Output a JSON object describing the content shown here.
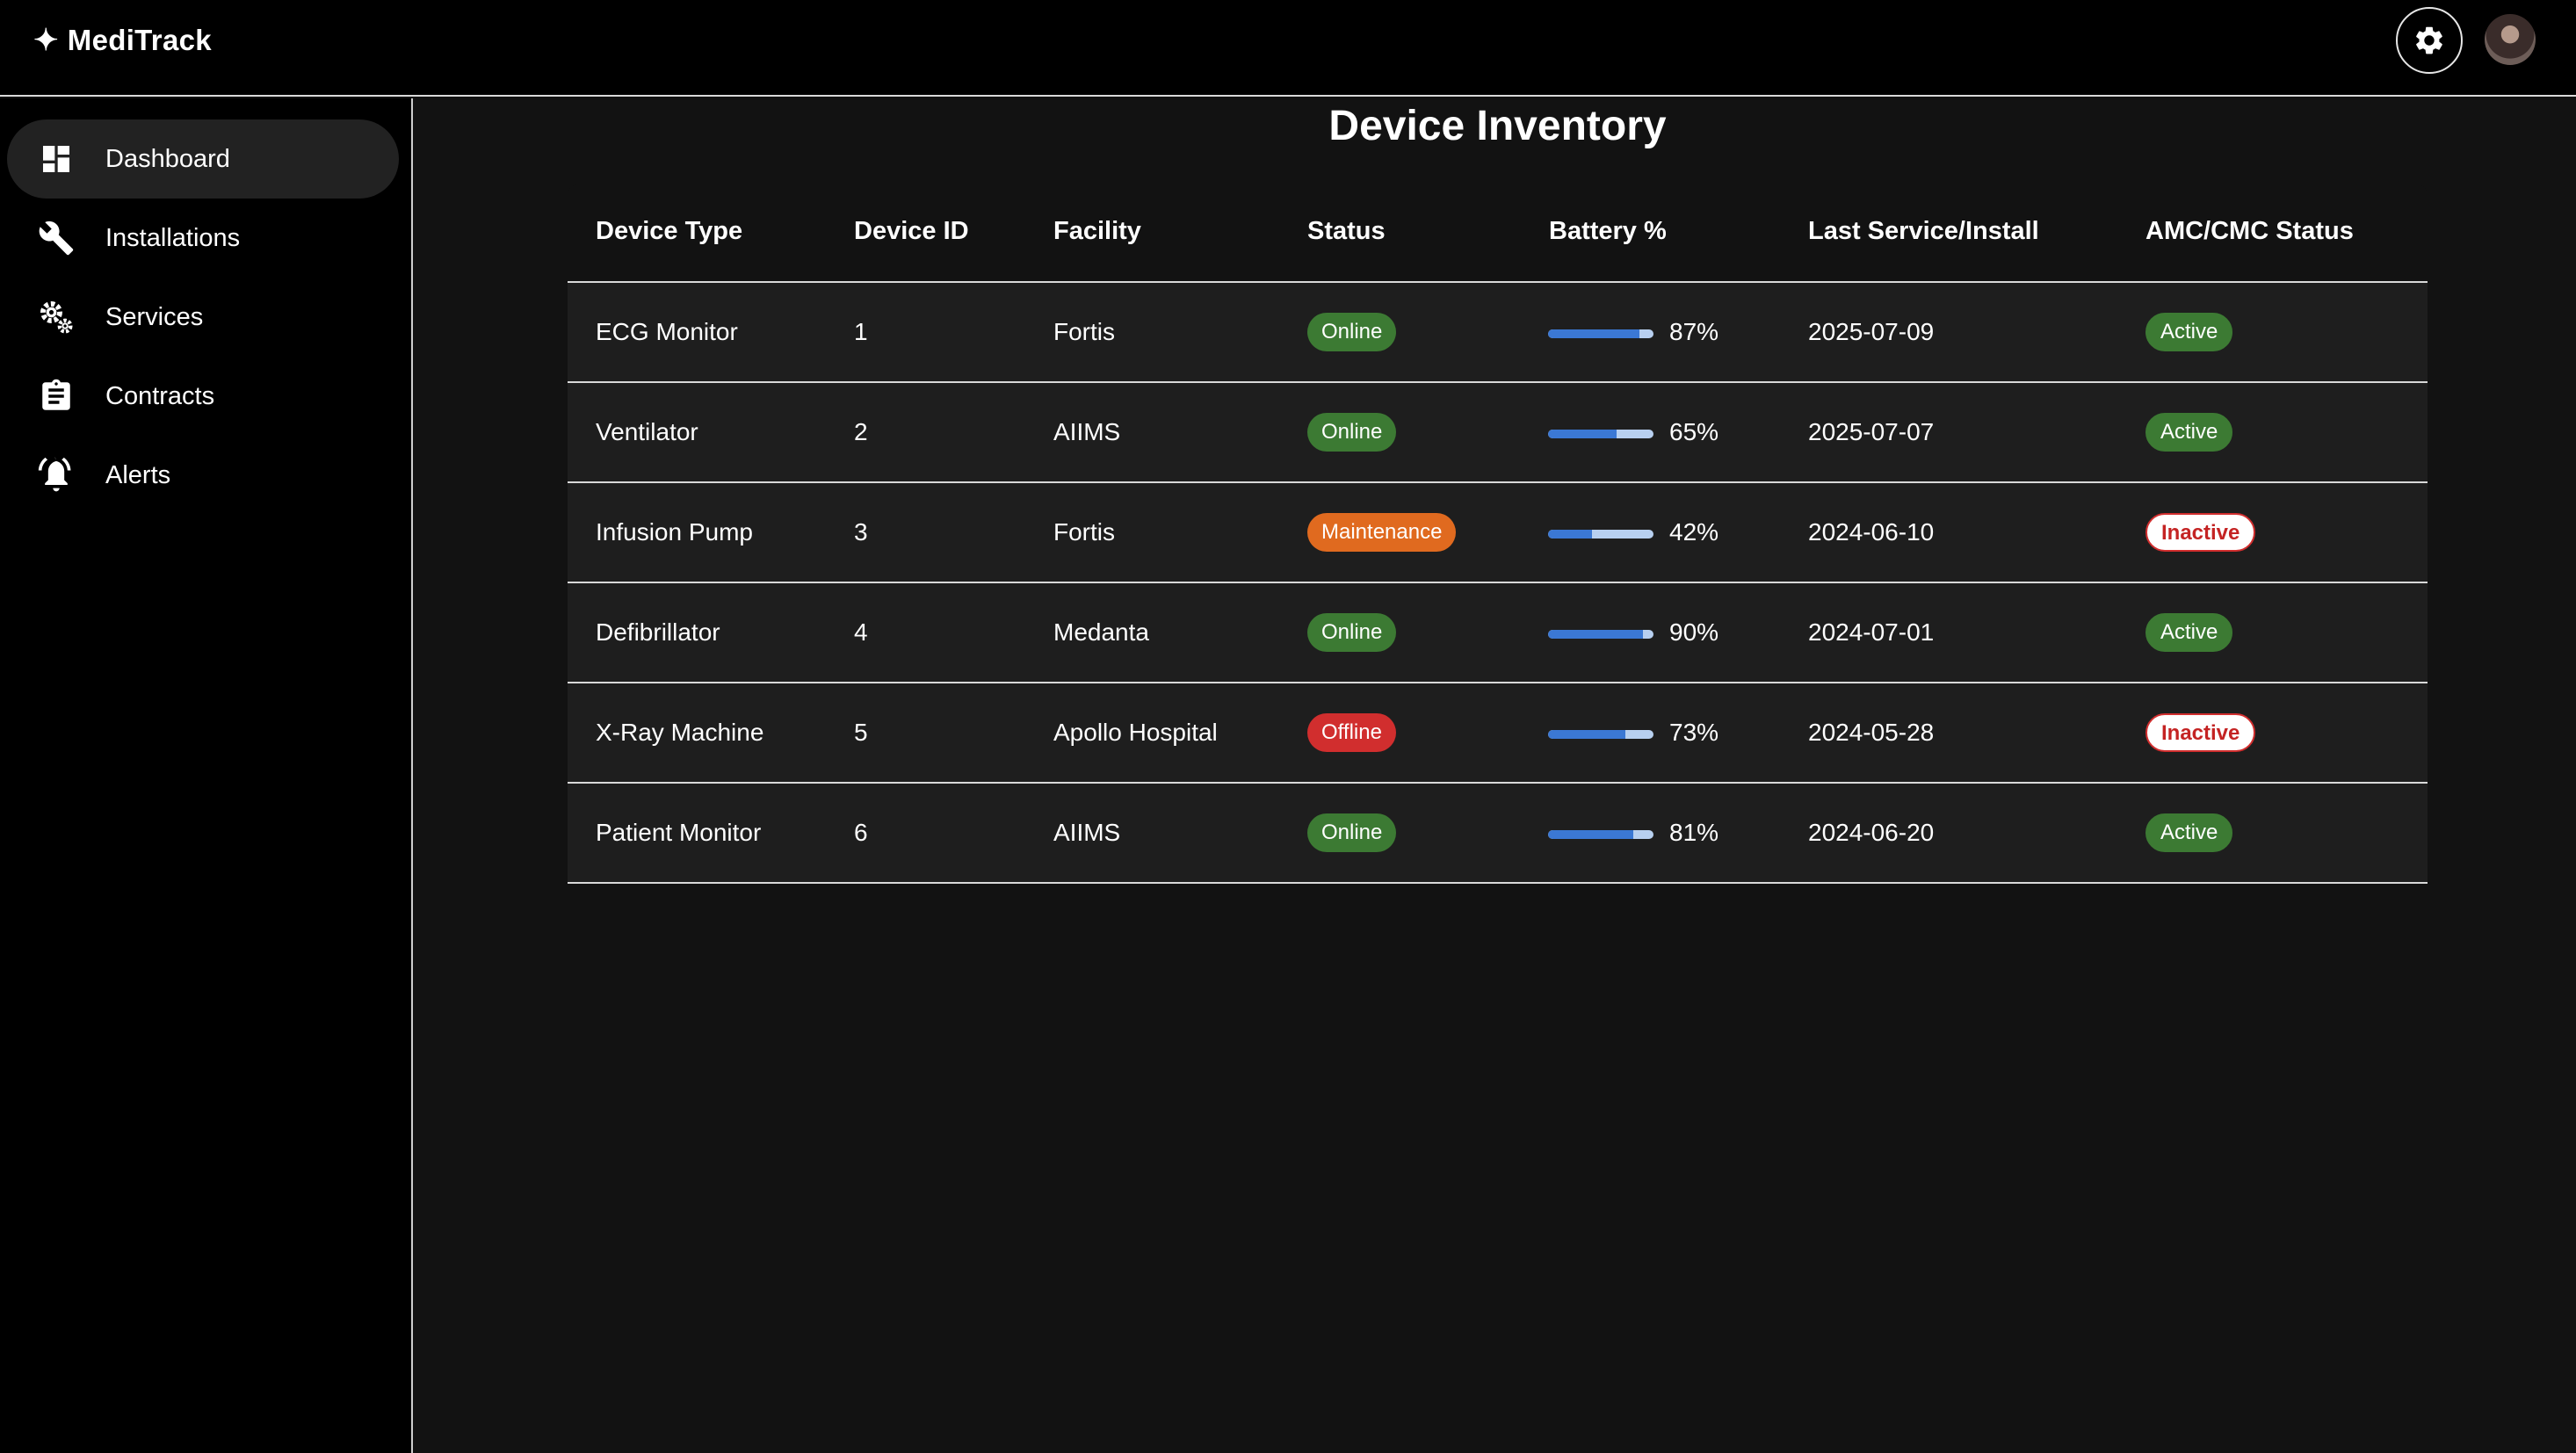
{
  "app": {
    "name": "MediTrack",
    "spark_glyph": "✦"
  },
  "header": {
    "settings_icon": "gear-icon",
    "avatar_icon": "user-avatar"
  },
  "sidebar": {
    "items": [
      {
        "label": "Dashboard",
        "icon": "dashboard-icon",
        "active": true
      },
      {
        "label": "Installations",
        "icon": "wrench-icon",
        "active": false
      },
      {
        "label": "Services",
        "icon": "gears-icon",
        "active": false
      },
      {
        "label": "Contracts",
        "icon": "clipboard-icon",
        "active": false
      },
      {
        "label": "Alerts",
        "icon": "bell-icon",
        "active": false
      }
    ]
  },
  "main": {
    "title": "Device Inventory",
    "table": {
      "columns": [
        "Device Type",
        "Device ID",
        "Facility",
        "Status",
        "Battery %",
        "Last Service/Install",
        "AMC/CMC Status"
      ],
      "rows": [
        {
          "device_type": "ECG Monitor",
          "device_id": "1",
          "facility": "Fortis",
          "status": "Online",
          "battery": 87,
          "battery_label": "87%",
          "last_service": "2025-07-09",
          "amc": "Active"
        },
        {
          "device_type": "Ventilator",
          "device_id": "2",
          "facility": "AIIMS",
          "status": "Online",
          "battery": 65,
          "battery_label": "65%",
          "last_service": "2025-07-07",
          "amc": "Active"
        },
        {
          "device_type": "Infusion Pump",
          "device_id": "3",
          "facility": "Fortis",
          "status": "Maintenance",
          "battery": 42,
          "battery_label": "42%",
          "last_service": "2024-06-10",
          "amc": "Inactive"
        },
        {
          "device_type": "Defibrillator",
          "device_id": "4",
          "facility": "Medanta",
          "status": "Online",
          "battery": 90,
          "battery_label": "90%",
          "last_service": "2024-07-01",
          "amc": "Active"
        },
        {
          "device_type": "X-Ray Machine",
          "device_id": "5",
          "facility": "Apollo Hospital",
          "status": "Offline",
          "battery": 73,
          "battery_label": "73%",
          "last_service": "2024-05-28",
          "amc": "Inactive"
        },
        {
          "device_type": "Patient Monitor",
          "device_id": "6",
          "facility": "AIIMS",
          "status": "Online",
          "battery": 81,
          "battery_label": "81%",
          "last_service": "2024-06-20",
          "amc": "Active"
        }
      ]
    }
  },
  "colors": {
    "online": "#3c7a33",
    "maintenance": "#e06a1f",
    "offline": "#d12e2e",
    "battery_fill": "#3b78d4",
    "battery_track": "#b8d0f0"
  }
}
